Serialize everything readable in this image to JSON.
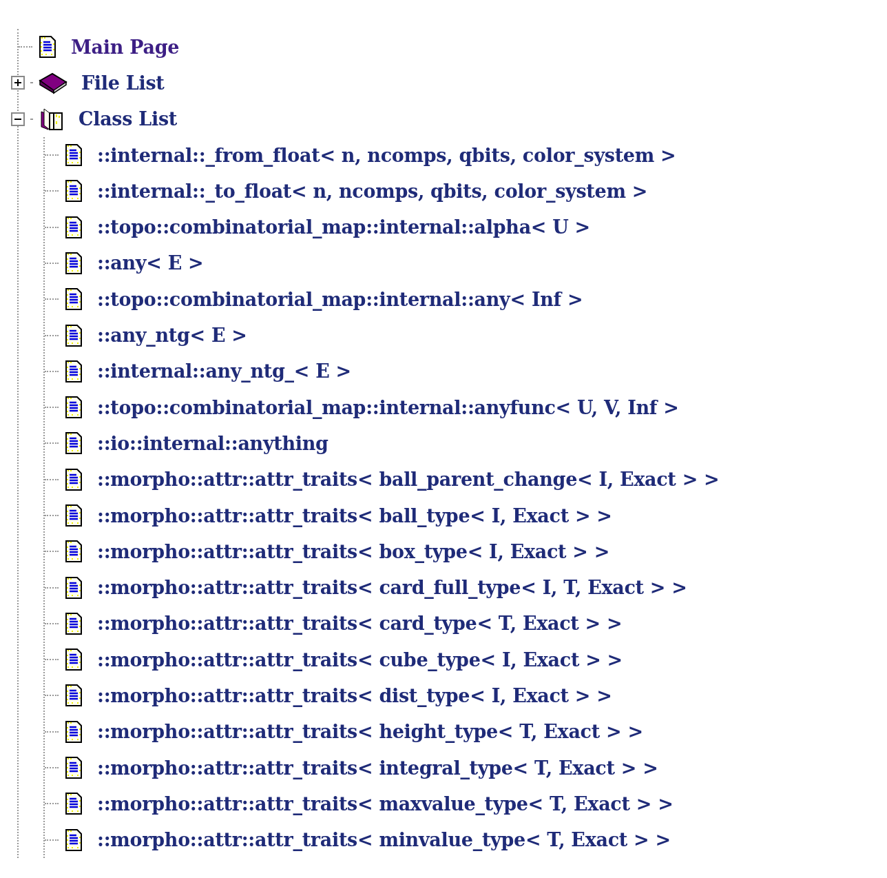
{
  "tree": [
    {
      "label": "Main Page",
      "kind": "page",
      "visited": true
    },
    {
      "label": "File List",
      "kind": "book",
      "visited": false,
      "expanded": false
    },
    {
      "label": "Class List",
      "kind": "book",
      "visited": false,
      "expanded": true,
      "children": [
        {
          "label": "::internal::_from_float< n, ncomps, qbits, color_system >",
          "kind": "page"
        },
        {
          "label": "::internal::_to_float< n, ncomps, qbits, color_system >",
          "kind": "page"
        },
        {
          "label": "::topo::combinatorial_map::internal::alpha< U >",
          "kind": "page"
        },
        {
          "label": "::any< E >",
          "kind": "page"
        },
        {
          "label": "::topo::combinatorial_map::internal::any< Inf >",
          "kind": "page"
        },
        {
          "label": "::any_ntg< E >",
          "kind": "page"
        },
        {
          "label": "::internal::any_ntg_< E >",
          "kind": "page"
        },
        {
          "label": "::topo::combinatorial_map::internal::anyfunc< U, V, Inf >",
          "kind": "page"
        },
        {
          "label": "::io::internal::anything",
          "kind": "page"
        },
        {
          "label": "::morpho::attr::attr_traits< ball_parent_change< I, Exact > >",
          "kind": "page"
        },
        {
          "label": "::morpho::attr::attr_traits< ball_type< I, Exact > >",
          "kind": "page"
        },
        {
          "label": "::morpho::attr::attr_traits< box_type< I, Exact > >",
          "kind": "page"
        },
        {
          "label": "::morpho::attr::attr_traits< card_full_type< I, T, Exact > >",
          "kind": "page"
        },
        {
          "label": "::morpho::attr::attr_traits< card_type< T, Exact > >",
          "kind": "page"
        },
        {
          "label": "::morpho::attr::attr_traits< cube_type< I, Exact > >",
          "kind": "page"
        },
        {
          "label": "::morpho::attr::attr_traits< dist_type< I, Exact > >",
          "kind": "page"
        },
        {
          "label": "::morpho::attr::attr_traits< height_type< T, Exact > >",
          "kind": "page"
        },
        {
          "label": "::morpho::attr::attr_traits< integral_type< T, Exact > >",
          "kind": "page"
        },
        {
          "label": "::morpho::attr::attr_traits< maxvalue_type< T, Exact > >",
          "kind": "page"
        },
        {
          "label": "::morpho::attr::attr_traits< minvalue_type< T, Exact > >",
          "kind": "page"
        }
      ]
    }
  ]
}
